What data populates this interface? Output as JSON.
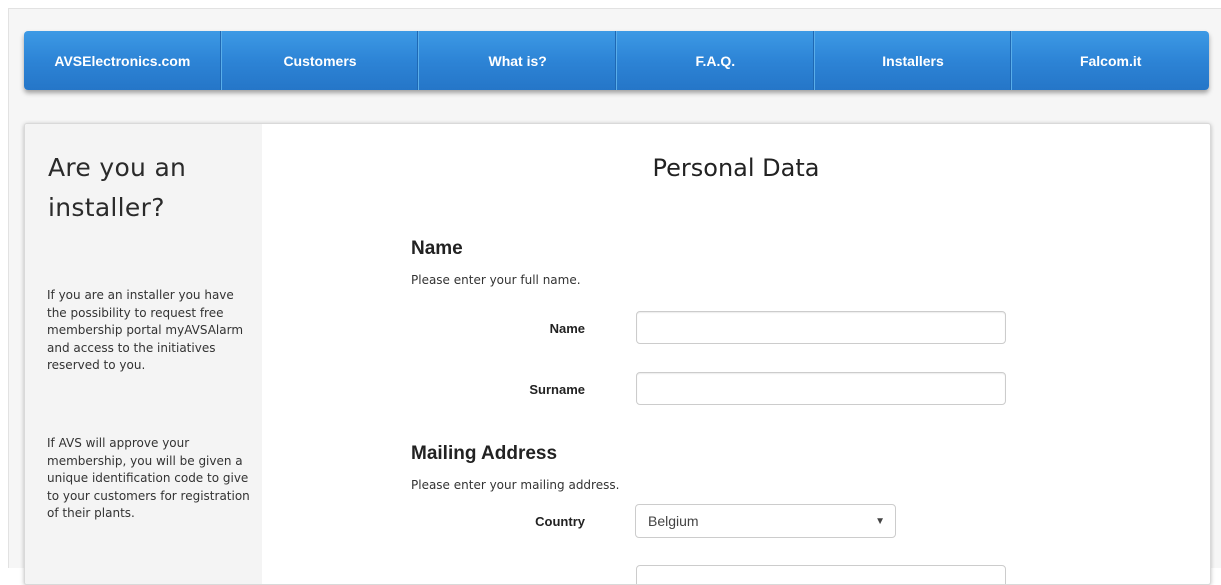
{
  "nav": {
    "items": [
      {
        "label": "AVSElectronics.com"
      },
      {
        "label": "Customers"
      },
      {
        "label": "What is?"
      },
      {
        "label": "F.A.Q."
      },
      {
        "label": "Installers"
      },
      {
        "label": "Falcom.it"
      }
    ],
    "color": "#2d84d6"
  },
  "sidebar": {
    "title": "Are you an installer?",
    "paragraph1": "If you are an installer you have the possibility to request free membership portal myAVSAlarm and access to the initiatives reserved to you.",
    "paragraph2": "If AVS will approve your membership, you will be given a unique identification code to give to your customers for registration of their plants."
  },
  "form": {
    "page_title": "Personal Data",
    "name_section": {
      "title": "Name",
      "description": "Please enter your full name.",
      "name_label": "Name",
      "name_value": "",
      "surname_label": "Surname",
      "surname_value": ""
    },
    "address_section": {
      "title": "Mailing Address",
      "description": "Please enter your mailing address.",
      "country_label": "Country",
      "country_value": "Belgium",
      "caret_icon": "▼"
    }
  }
}
